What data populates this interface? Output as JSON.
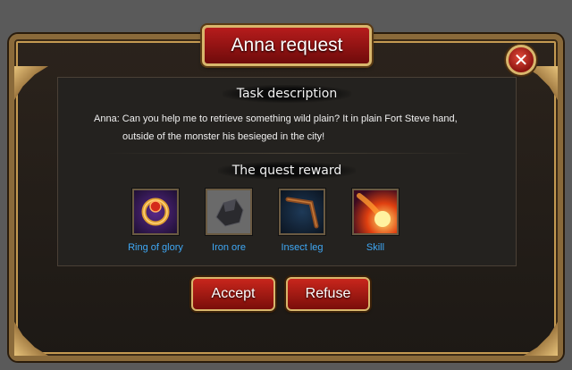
{
  "dialog": {
    "title": "Anna request",
    "close_symbol": "✕"
  },
  "task": {
    "heading": "Task description",
    "text_line1": "Anna: Can you help me to retrieve something wild plain? It in plain Fort Steve hand,",
    "text_line2": "outside of the monster his besieged in the city!"
  },
  "reward": {
    "heading": "The quest reward",
    "items": [
      {
        "name": "Ring of glory",
        "icon": "ring-icon"
      },
      {
        "name": "Iron ore",
        "icon": "ore-icon"
      },
      {
        "name": "Insect leg",
        "icon": "insect-leg-icon"
      },
      {
        "name": "Skill",
        "icon": "fireball-icon"
      }
    ]
  },
  "buttons": {
    "accept": "Accept",
    "refuse": "Refuse"
  },
  "colors": {
    "reward_name": "#3fa8f5",
    "button_red": "#c8261c",
    "gold_trim": "#d8b66c"
  }
}
